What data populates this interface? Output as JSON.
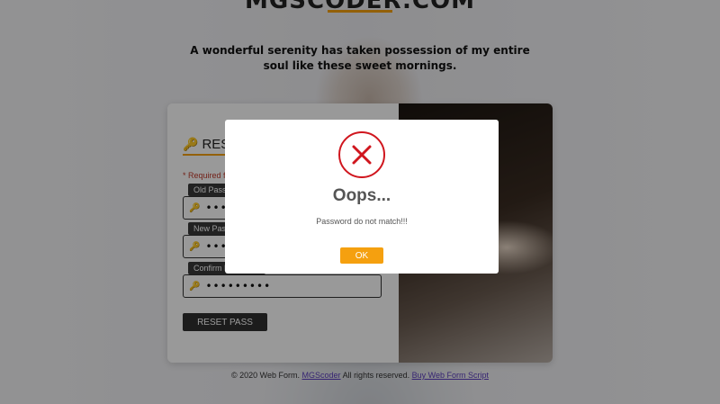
{
  "header": {
    "brand": "MGSCODER.COM",
    "tagline": "A wonderful serenity has taken possession of my entire soul like these sweet mornings."
  },
  "form": {
    "title": "RESET PASSWORD",
    "required_note": "* Required fields",
    "fields": [
      {
        "label": "Old Password",
        "value": "•••••••••"
      },
      {
        "label": "New Password",
        "value": "•••••••••"
      },
      {
        "label": "Confirm Password",
        "value": "•••••••••"
      }
    ],
    "submit_label": "RESET PASS"
  },
  "footer": {
    "text_prefix": "© 2020 Web Form.",
    "link1": "MGScoder",
    "text_middle": "All rights reserved.",
    "link2": "Buy Web Form Script"
  },
  "dialog": {
    "title": "Oops...",
    "message": "Password do not match!!!",
    "ok_label": "OK",
    "icon": "error-x-icon",
    "colors": {
      "icon": "#d0161e",
      "button": "#f5a00f"
    }
  }
}
